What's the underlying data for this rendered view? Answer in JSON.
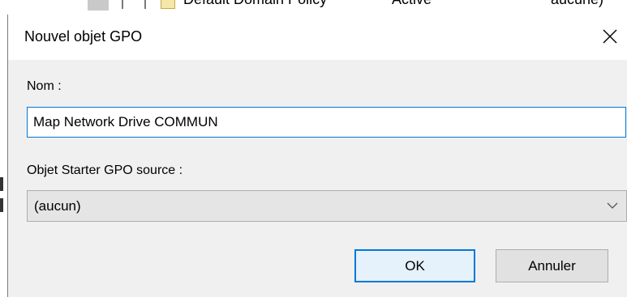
{
  "background_window": {
    "gpo_name": "Default Domain Policy",
    "status": "Active",
    "filter": "aucune)"
  },
  "dialog": {
    "title": "Nouvel objet GPO",
    "close_icon": "close-icon",
    "name_label": "Nom :",
    "name_value": "Map Network Drive COMMUN",
    "starter_label": "Objet Starter GPO source :",
    "starter_value": "(aucun)",
    "dropdown_icon": "chevron-down-icon",
    "ok_label": "OK",
    "cancel_label": "Annuler"
  },
  "colors": {
    "focus_border": "#0078d7",
    "dialog_background": "#f0f0f0",
    "title_bar_background": "#ffffff",
    "default_button_background": "#e5f1fb"
  }
}
